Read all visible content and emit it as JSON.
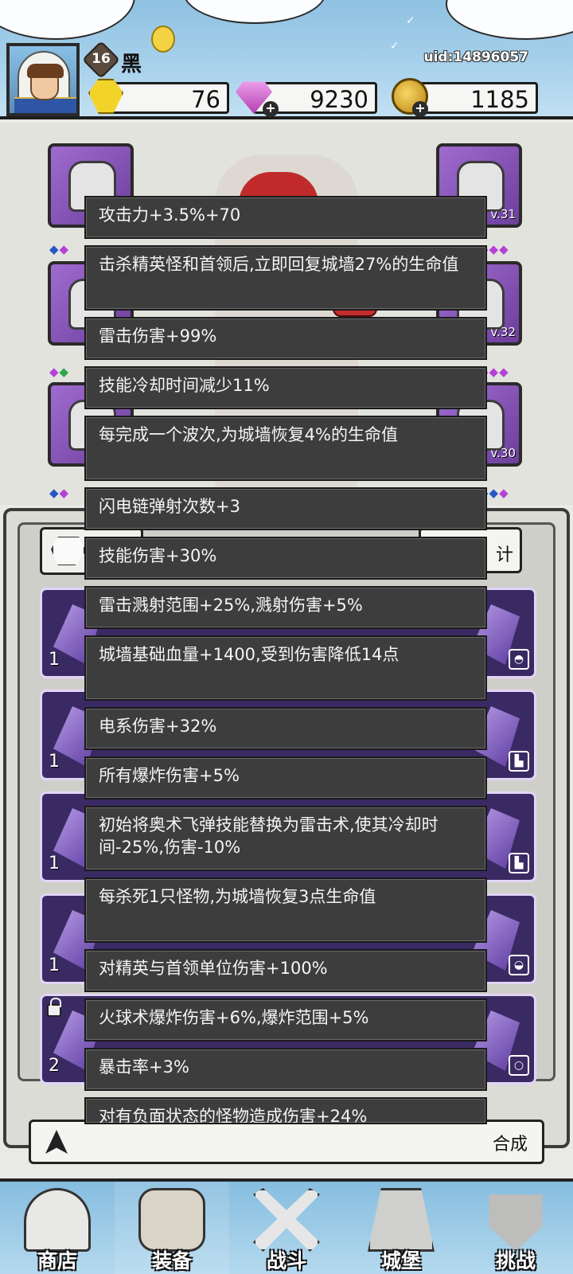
{
  "header": {
    "player_level": "16",
    "player_name": "黑",
    "uid": "uid:14896057",
    "resources": [
      {
        "icon": "yellow-gem-icon",
        "value": "76"
      },
      {
        "icon": "purple-diamond-icon",
        "value": "9230"
      },
      {
        "icon": "gold-coin-icon",
        "value": "1185"
      }
    ]
  },
  "equipment": {
    "slot_levels": [
      "v.31",
      "v.32",
      "v.30"
    ]
  },
  "bag": {
    "stats_button": "计",
    "counts": [
      "1",
      "1",
      "1",
      "1",
      "2"
    ],
    "merge_button": "合成"
  },
  "tooltip": {
    "lines": [
      "攻击力+3.5%+70",
      "击杀精英怪和首领后,立即回复城墙27%的生命值",
      "雷击伤害+99%",
      "技能冷却时间减少11%",
      "每完成一个波次,为城墙恢复4%的生命值",
      "闪电链弹射次数+3",
      "技能伤害+30%",
      "雷击溅射范围+25%,溅射伤害+5%",
      "城墙基础血量+1400,受到伤害降低14点",
      "电系伤害+32%",
      "所有爆炸伤害+5%",
      "初始将奥术飞弹技能替换为雷击术,使其冷却时间-25%,伤害-10%",
      "每杀死1只怪物,为城墙恢复3点生命值",
      "对精英与首领单位伤害+100%",
      "火球术爆炸伤害+6%,爆炸范围+5%",
      "暴击率+3%",
      "对有负面状态的怪物造成伤害+24%"
    ]
  },
  "nav": {
    "items": [
      {
        "label": "商店",
        "icon": "shop-icon"
      },
      {
        "label": "装备",
        "icon": "backpack-icon"
      },
      {
        "label": "战斗",
        "icon": "crossed-swords-icon"
      },
      {
        "label": "城堡",
        "icon": "castle-icon"
      },
      {
        "label": "挑战",
        "icon": "shield-icon"
      }
    ]
  }
}
